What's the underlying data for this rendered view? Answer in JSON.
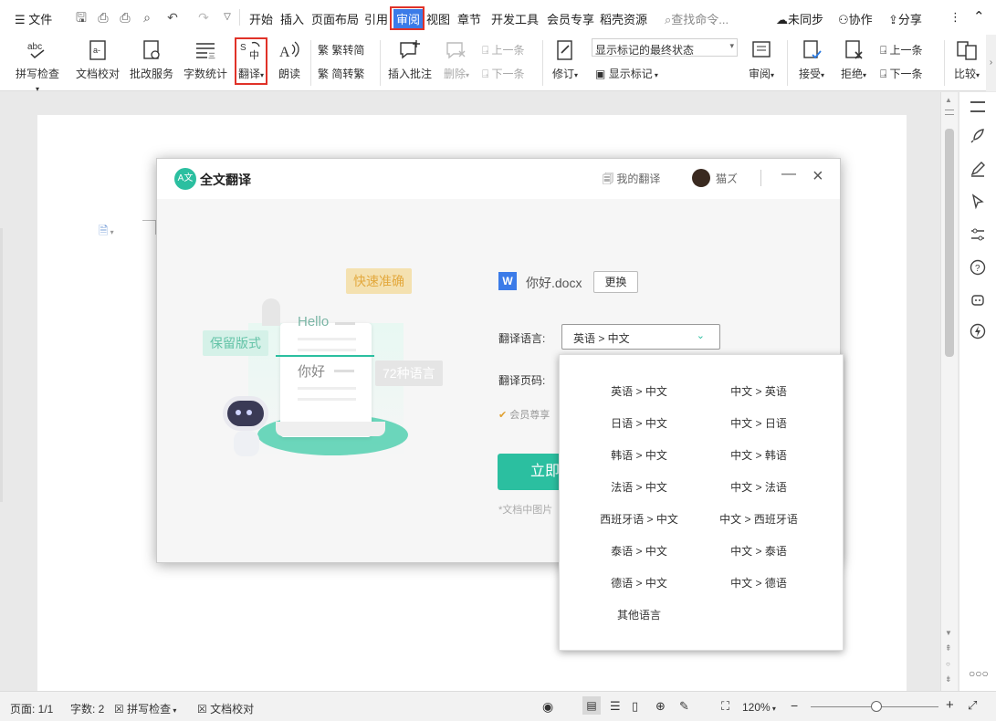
{
  "menubar": {
    "file_label": "文件",
    "tabs": [
      "开始",
      "插入",
      "页面布局",
      "引用",
      "审阅",
      "视图",
      "章节",
      "开发工具",
      "会员专享",
      "稻壳资源"
    ],
    "search_placeholder": "查找命令...",
    "sync_label": "未同步",
    "collab_label": "协作",
    "share_label": "分享"
  },
  "ribbon": {
    "spell_check": "拼写检查",
    "doc_proof": "文档校对",
    "correction_service": "批改服务",
    "word_count": "字数统计",
    "translate": "翻译",
    "read_aloud": "朗读",
    "trad_to_simp": "繁转简",
    "simp_to_trad": "简转繁",
    "insert_comment": "插入批注",
    "delete": "删除",
    "prev": "上一条",
    "next": "下一条",
    "track_changes": "修订",
    "markup_state": "显示标记的最终状态",
    "show_markup": "显示标记",
    "review": "审阅",
    "accept": "接受",
    "reject": "拒绝",
    "prev2": "上一条",
    "next2": "下一条",
    "compare": "比较"
  },
  "dialog": {
    "title": "全文翻译",
    "my_translations": "我的翻译",
    "username": "猫ズ",
    "illus_tag_fast": "快速准确",
    "illus_tag_keep": "保留版式",
    "illus_tag_langs": "72种语言",
    "illus_hello": "Hello",
    "illus_nihao": "你好",
    "filename": "你好.docx",
    "change_btn": "更换",
    "lang_label": "翻译语言:",
    "lang_value": "英语 > 中文",
    "pages_label": "翻译页码:",
    "member_text": "会员尊享",
    "start_btn": "立即",
    "footnote": "*文档中图片"
  },
  "dropdown": {
    "left": [
      "英语 > 中文",
      "日语 > 中文",
      "韩语 > 中文",
      "法语 > 中文",
      "西班牙语 > 中文",
      "泰语 > 中文",
      "德语 > 中文",
      "其他语言"
    ],
    "right": [
      "中文 > 英语",
      "中文 > 日语",
      "中文 > 韩语",
      "中文 > 法语",
      "中文 > 西班牙语",
      "中文 > 泰语",
      "中文 > 德语"
    ]
  },
  "status": {
    "page": "页面: 1/1",
    "word_count": "字数: 2",
    "spell_check": "拼写检查",
    "doc_proof": "文档校对",
    "zoom": "120%"
  },
  "colors": {
    "accent": "#2bbfa0",
    "highlight": "#e03228",
    "tab_active_bg": "#3b7be8"
  }
}
